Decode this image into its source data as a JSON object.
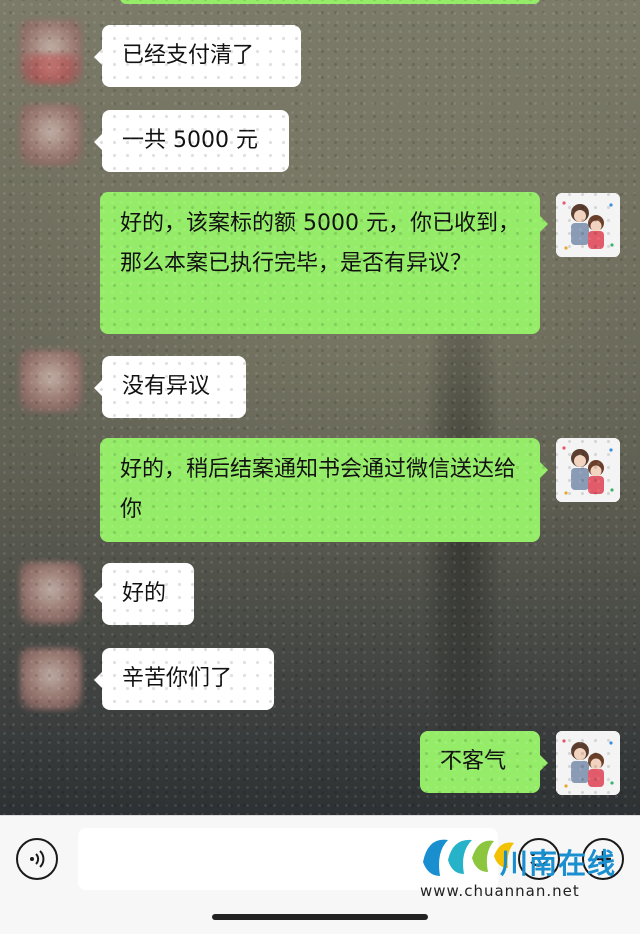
{
  "messages": [
    {
      "side": "left",
      "text": "已经支付清了"
    },
    {
      "side": "left",
      "text": "一共 5000 元"
    },
    {
      "side": "right",
      "text": "好的，该案标的额 5000 元，你已收到，那么本案已执行完毕，是否有异议？"
    },
    {
      "side": "left",
      "text": "没有异议"
    },
    {
      "side": "right",
      "text": "好的，稍后结案通知书会通过微信送达给你"
    },
    {
      "side": "left",
      "text": "好的"
    },
    {
      "side": "left",
      "text": "辛苦你们了"
    },
    {
      "side": "right",
      "text": "不客气"
    }
  ],
  "input_bar": {
    "voice_icon": "voice-icon",
    "emoji_icon": "emoji-icon",
    "plus_icon": "plus-icon",
    "input_value": ""
  },
  "watermark": {
    "name": "川南在线",
    "url": "www.chuannan.net"
  },
  "colors": {
    "outgoing_bubble": "#95ec69",
    "incoming_bubble": "#ffffff",
    "watermark_blue": "#1a8fd0"
  }
}
